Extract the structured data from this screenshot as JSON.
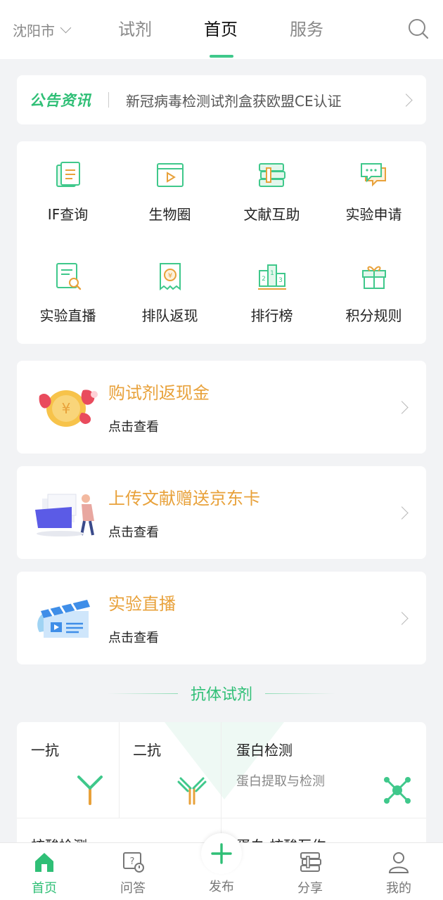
{
  "header": {
    "city": "沈阳市",
    "tabs": [
      "试剂",
      "首页",
      "服务"
    ],
    "active_tab": "首页"
  },
  "notice": {
    "tag": "公告资讯",
    "text": "新冠病毒检测试剂盒获欧盟CE认证"
  },
  "grid": {
    "items": [
      {
        "label": "IF查询",
        "icon": "document-icon"
      },
      {
        "label": "生物圈",
        "icon": "video-icon"
      },
      {
        "label": "文献互助",
        "icon": "books-icon"
      },
      {
        "label": "实验申请",
        "icon": "chat-icon"
      },
      {
        "label": "实验直播",
        "icon": "report-search-icon"
      },
      {
        "label": "排队返现",
        "icon": "receipt-yen-icon"
      },
      {
        "label": "排行榜",
        "icon": "podium-icon"
      },
      {
        "label": "积分规则",
        "icon": "gift-icon"
      }
    ]
  },
  "promos": [
    {
      "title": "购试剂返现金",
      "sub": "点击查看",
      "icon": "coin-illustration"
    },
    {
      "title": "上传文献赠送京东卡",
      "sub": "点击查看",
      "icon": "upload-illustration"
    },
    {
      "title": "实验直播",
      "sub": "点击查看",
      "icon": "clapperboard-illustration"
    }
  ],
  "section": {
    "title": "抗体试剂"
  },
  "products": [
    {
      "name": "一抗"
    },
    {
      "name": "二抗"
    },
    {
      "name": "蛋白检测",
      "desc": "蛋白提取与检测"
    },
    {
      "name": "核酸检测"
    },
    {
      "name": "蛋白-核酸互作"
    }
  ],
  "bottom_nav": [
    {
      "label": "首页",
      "icon": "home-icon"
    },
    {
      "label": "问答",
      "icon": "question-icon"
    },
    {
      "label": "发布",
      "icon": "plus-icon"
    },
    {
      "label": "分享",
      "icon": "share-books-icon"
    },
    {
      "label": "我的",
      "icon": "user-icon"
    }
  ],
  "colors": {
    "accent": "#3fc88b",
    "promo_title": "#e8a13a"
  }
}
